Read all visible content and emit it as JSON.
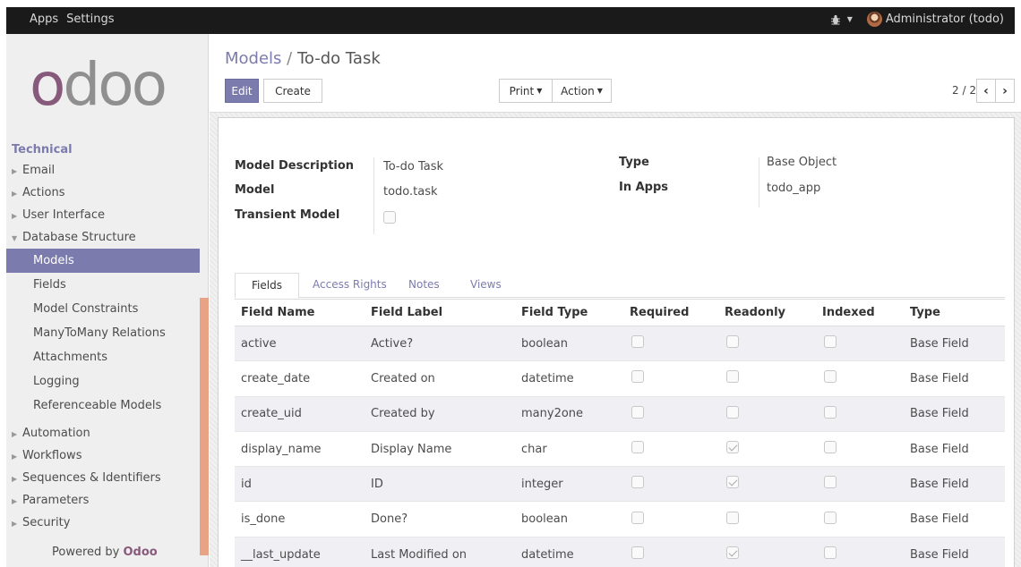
{
  "topbar": {
    "menu": [
      "Apps",
      "Settings"
    ],
    "user": "Administrator (todo)",
    "debug_icon": "bug-icon"
  },
  "sidebar": {
    "logo": "odoo",
    "section": "Technical",
    "items_top": [
      "Email",
      "Actions",
      "User Interface",
      "Database Structure"
    ],
    "sub_items": [
      "Models",
      "Fields",
      "Model Constraints",
      "ManyToMany Relations",
      "Attachments",
      "Logging",
      "Referenceable Models"
    ],
    "active_sub": "Models",
    "items_bottom": [
      "Automation",
      "Workflows",
      "Sequences & Identifiers",
      "Parameters",
      "Security"
    ],
    "powered_prefix": "Powered by",
    "powered_brand": "Odoo"
  },
  "control": {
    "breadcrumb_parent": "Models",
    "breadcrumb_sep": "/",
    "breadcrumb_current": "To-do Task",
    "edit_label": "Edit",
    "create_label": "Create",
    "print_label": "Print",
    "action_label": "Action",
    "pager": "2 / 2"
  },
  "form": {
    "model_description_label": "Model Description",
    "model_description": "To-do Task",
    "model_label": "Model",
    "model": "todo.task",
    "transient_label": "Transient Model",
    "transient": false,
    "type_label": "Type",
    "type": "Base Object",
    "in_apps_label": "In Apps",
    "in_apps": "todo_app"
  },
  "tabs": [
    "Fields",
    "Access Rights",
    "Notes",
    "Views"
  ],
  "active_tab": "Fields",
  "fields_table": {
    "columns": [
      "Field Name",
      "Field Label",
      "Field Type",
      "Required",
      "Readonly",
      "Indexed",
      "Type"
    ],
    "rows": [
      {
        "name": "active",
        "label": "Active?",
        "ftype": "boolean",
        "required": false,
        "readonly": false,
        "indexed": false,
        "type": "Base Field"
      },
      {
        "name": "create_date",
        "label": "Created on",
        "ftype": "datetime",
        "required": false,
        "readonly": false,
        "indexed": false,
        "type": "Base Field"
      },
      {
        "name": "create_uid",
        "label": "Created by",
        "ftype": "many2one",
        "required": false,
        "readonly": false,
        "indexed": false,
        "type": "Base Field"
      },
      {
        "name": "display_name",
        "label": "Display Name",
        "ftype": "char",
        "required": false,
        "readonly": true,
        "indexed": false,
        "type": "Base Field"
      },
      {
        "name": "id",
        "label": "ID",
        "ftype": "integer",
        "required": false,
        "readonly": true,
        "indexed": false,
        "type": "Base Field"
      },
      {
        "name": "is_done",
        "label": "Done?",
        "ftype": "boolean",
        "required": false,
        "readonly": false,
        "indexed": false,
        "type": "Base Field"
      },
      {
        "name": "__last_update",
        "label": "Last Modified on",
        "ftype": "datetime",
        "required": false,
        "readonly": true,
        "indexed": false,
        "type": "Base Field"
      }
    ]
  },
  "colors": {
    "topbar": "#1a1a1a",
    "brand": "#7c7bad",
    "logo_o": "#875a7b",
    "accent_bar": "#e8a285"
  }
}
